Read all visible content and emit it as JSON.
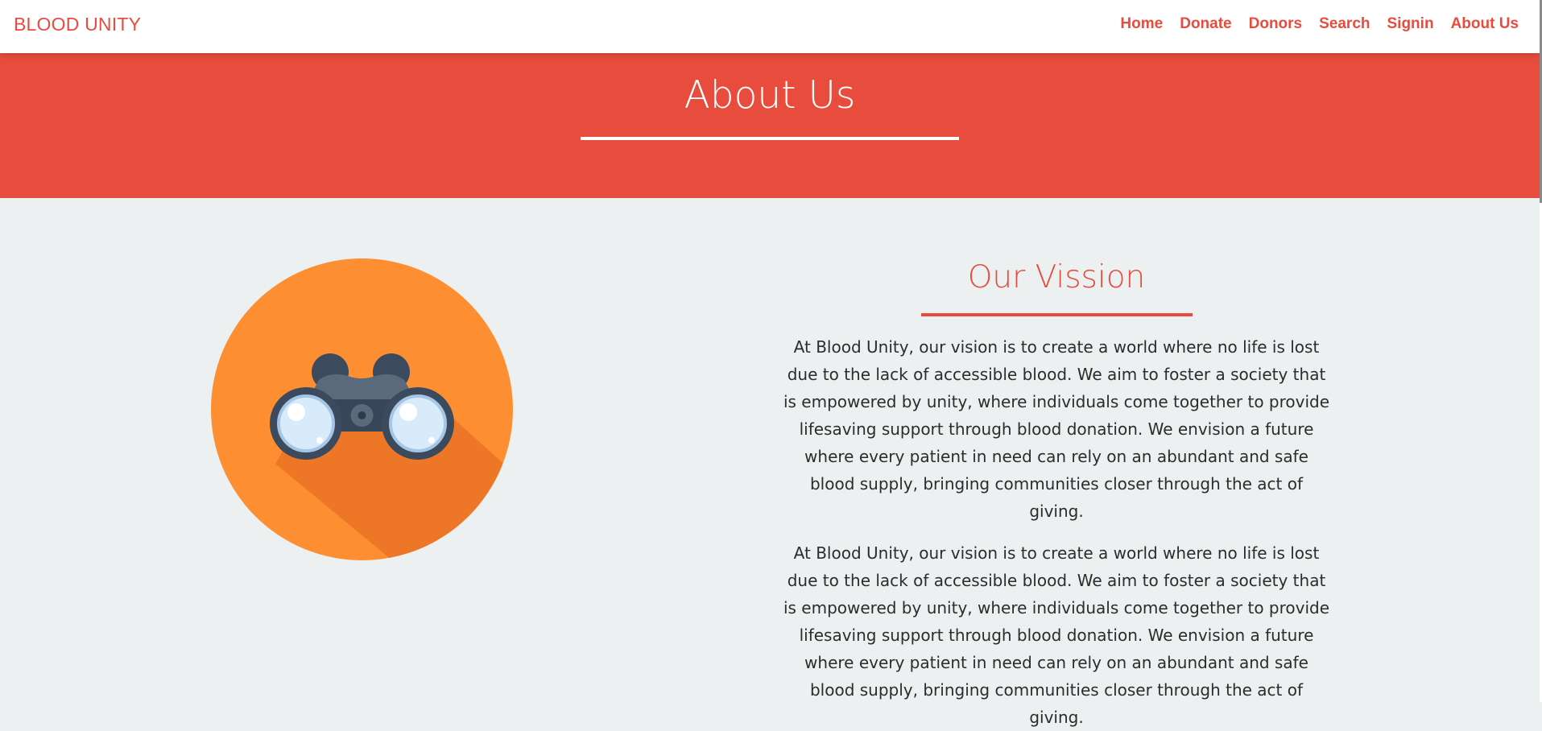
{
  "brand": "BLOOD UNITY",
  "nav": {
    "items": [
      "Home",
      "Donate",
      "Donors",
      "Search",
      "Signin",
      "About Us"
    ]
  },
  "hero": {
    "title": "About Us"
  },
  "vision": {
    "title": "Our Vission",
    "paragraphs": [
      "At Blood Unity, our vision is to create a world where no life is lost due to the lack of accessible blood. We aim to foster a society that is empowered by unity, where individuals come together to provide lifesaving support through blood donation. We envision a future where every patient in need can rely on an abundant and safe blood supply, bringing communities closer through the act of giving.",
      "At Blood Unity, our vision is to create a world where no life is lost due to the lack of accessible blood. We aim to foster a society that is empowered by unity, where individuals come together to provide lifesaving support through blood donation. We envision a future where every patient in need can rely on an abundant and safe blood supply, bringing communities closer through the act of giving."
    ]
  },
  "icons": {
    "vision_emblem": "binoculars-icon"
  },
  "colors": {
    "accent": "#e74c3c",
    "page_background": "#ecf0f1",
    "emblem_circle": "#fd8f32",
    "emblem_shadow": "#ee7727",
    "binocular_body": "#5a6a7b",
    "binocular_lens": "#d8ebfa"
  }
}
